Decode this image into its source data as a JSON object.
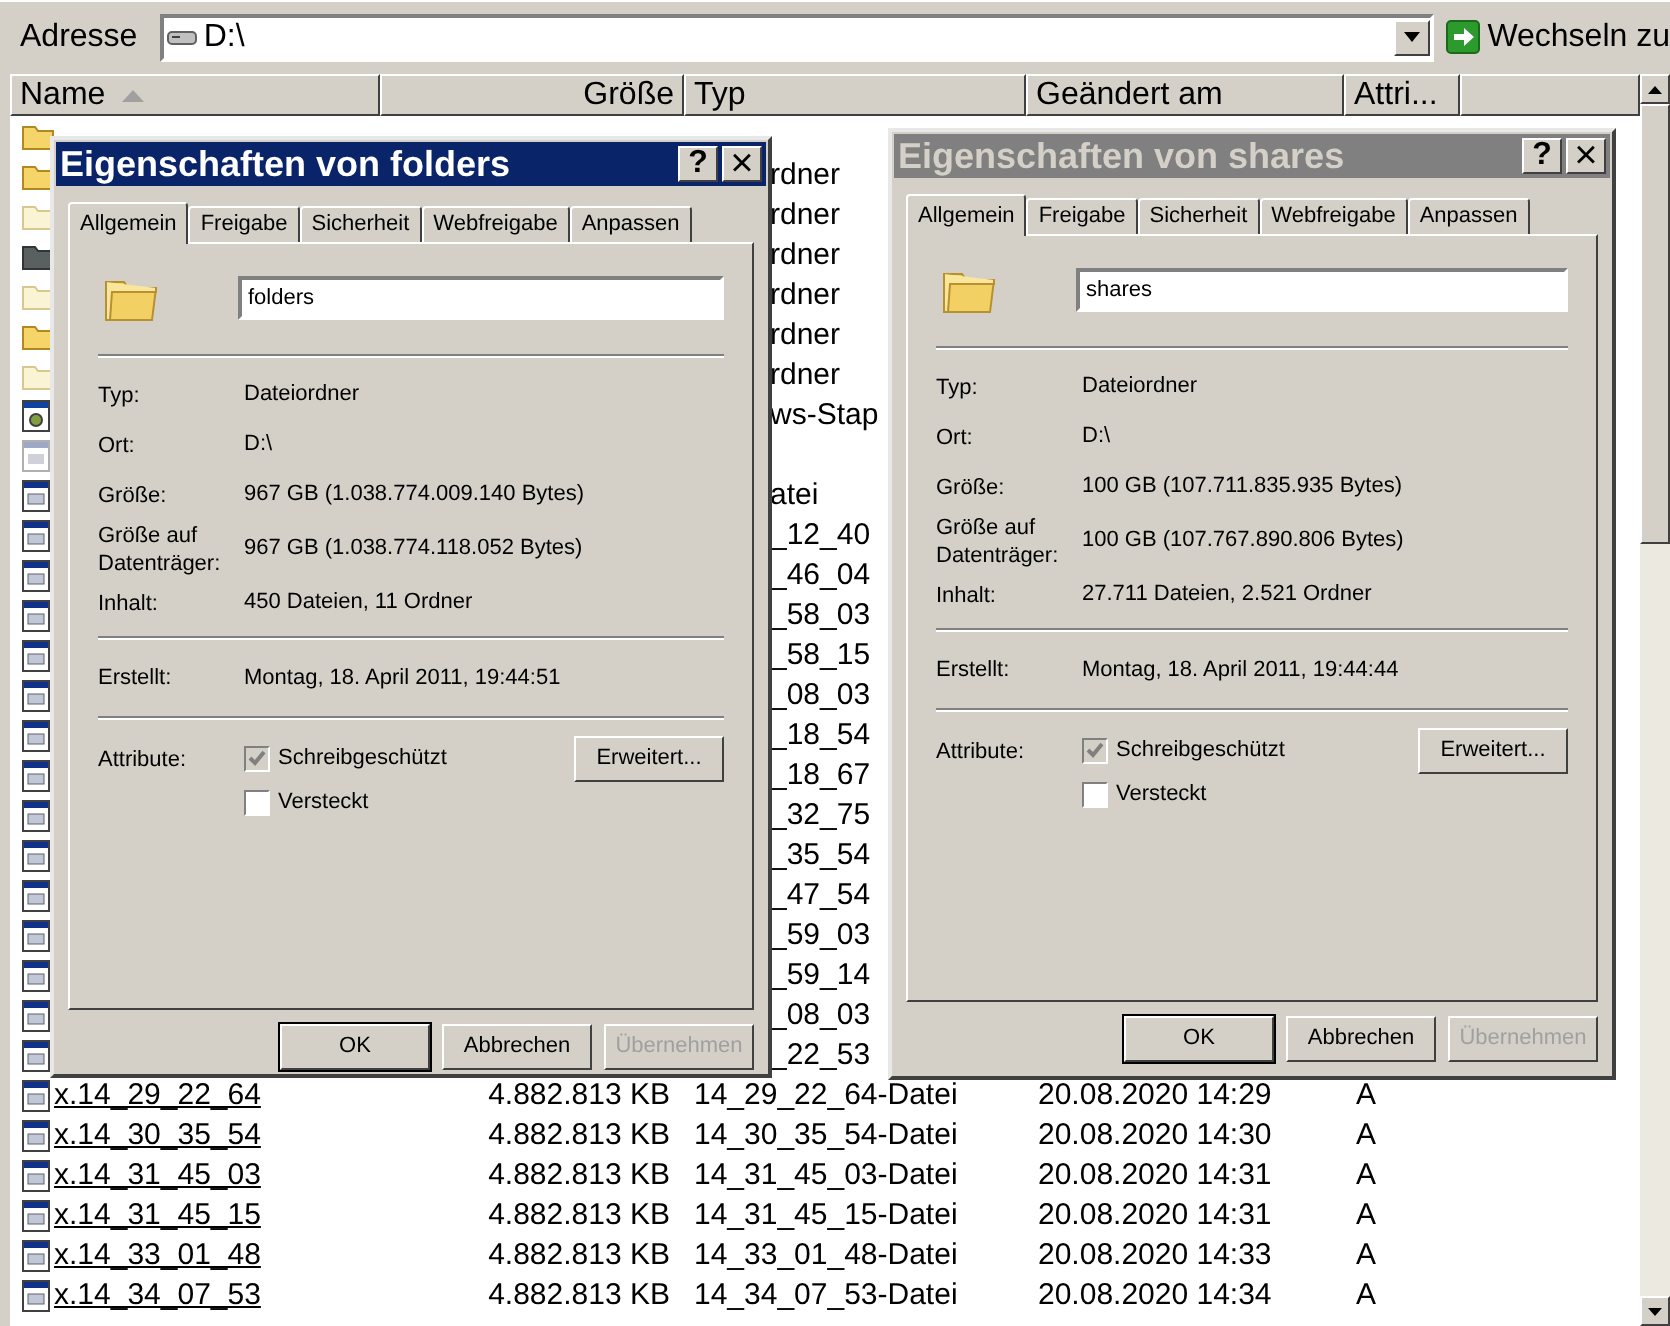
{
  "address_bar": {
    "label": "Adresse",
    "value": "D:\\",
    "go_button": "Wechseln zu"
  },
  "file_list": {
    "columns": [
      {
        "label": "Name",
        "sorted": true
      },
      {
        "label": "Größe",
        "sorted": false
      },
      {
        "label": "Typ",
        "sorted": false
      },
      {
        "label": "Geändert am",
        "sorted": false
      },
      {
        "label": "Attri...",
        "sorted": false
      }
    ],
    "rows": [
      {
        "kind": "folder"
      },
      {
        "kind": "folder",
        "type": "rdner"
      },
      {
        "kind": "ghostfolder",
        "type": "rdner"
      },
      {
        "kind": "darkfolder",
        "type": "rdner"
      },
      {
        "kind": "ghostfolder",
        "type": "rdner"
      },
      {
        "kind": "folder",
        "type": "rdner"
      },
      {
        "kind": "ghostfolder",
        "type": "rdner"
      },
      {
        "kind": "program",
        "type": "ws-Stap"
      },
      {
        "kind": "ghostfile"
      },
      {
        "kind": "file",
        "type": "atei"
      },
      {
        "kind": "file",
        "type": "_12_40"
      },
      {
        "kind": "file",
        "type": "_46_04"
      },
      {
        "kind": "file",
        "type": "_58_03"
      },
      {
        "kind": "file",
        "type": "_58_15"
      },
      {
        "kind": "file",
        "type": "_08_03"
      },
      {
        "kind": "file",
        "type": "_18_54"
      },
      {
        "kind": "file",
        "type": "_18_67"
      },
      {
        "kind": "file",
        "type": "_32_75"
      },
      {
        "kind": "file",
        "type": "_35_54"
      },
      {
        "kind": "file",
        "type": "_47_54"
      },
      {
        "kind": "file",
        "type": "_59_03"
      },
      {
        "kind": "file",
        "type": "_59_14"
      },
      {
        "kind": "file",
        "type": "_08_03"
      },
      {
        "kind": "file",
        "type": "_22_53"
      },
      {
        "kind": "file",
        "name": "x.14_29_22_64",
        "size": "4.882.813 KB",
        "type": "14_29_22_64-Datei",
        "modified": "20.08.2020 14:29",
        "attributes": "A"
      },
      {
        "kind": "file",
        "name": "x.14_30_35_54",
        "size": "4.882.813 KB",
        "type": "14_30_35_54-Datei",
        "modified": "20.08.2020 14:30",
        "attributes": "A"
      },
      {
        "kind": "file",
        "name": "x.14_31_45_03",
        "size": "4.882.813 KB",
        "type": "14_31_45_03-Datei",
        "modified": "20.08.2020 14:31",
        "attributes": "A"
      },
      {
        "kind": "file",
        "name": "x.14_31_45_15",
        "size": "4.882.813 KB",
        "type": "14_31_45_15-Datei",
        "modified": "20.08.2020 14:31",
        "attributes": "A"
      },
      {
        "kind": "file",
        "name": "x.14_33_01_48",
        "size": "4.882.813 KB",
        "type": "14_33_01_48-Datei",
        "modified": "20.08.2020 14:33",
        "attributes": "A"
      },
      {
        "kind": "file",
        "name": "x.14_34_07_53",
        "size": "4.882.813 KB",
        "type": "14_34_07_53-Datei",
        "modified": "20.08.2020 14:34",
        "attributes": "A"
      }
    ]
  },
  "dialogs": [
    {
      "title": "Eigenschaften von folders",
      "active": true,
      "help": "?",
      "close": "×",
      "tabs": [
        {
          "label": "Allgemein",
          "selected": true
        },
        {
          "label": "Freigabe",
          "selected": false
        },
        {
          "label": "Sicherheit",
          "selected": false
        },
        {
          "label": "Webfreigabe",
          "selected": false
        },
        {
          "label": "Anpassen",
          "selected": false
        }
      ],
      "name": "folders",
      "info": [
        {
          "label": "Typ:",
          "value": "Dateiordner"
        },
        {
          "label": "Ort:",
          "value": "D:\\"
        },
        {
          "label": "Größe:",
          "value": "967 GB (1.038.774.009.140 Bytes)"
        },
        {
          "label": "Größe auf Datenträger:",
          "value": "967 GB (1.038.774.118.052 Bytes)"
        },
        {
          "label": "Inhalt:",
          "value": "450 Dateien, 11 Ordner"
        }
      ],
      "created": {
        "label": "Erstellt:",
        "value": "Montag, 18. April 2011, 19:44:51"
      },
      "attributes_label": "Attribute:",
      "attributes": [
        {
          "label": "Schreibgeschützt",
          "checked": true,
          "greyed": true
        },
        {
          "label": "Versteckt",
          "checked": false,
          "greyed": false
        }
      ],
      "advanced_button": "Erweitert...",
      "buttons": [
        {
          "label": "OK",
          "default": true,
          "disabled": false
        },
        {
          "label": "Abbrechen",
          "default": false,
          "disabled": false
        },
        {
          "label": "Übernehmen",
          "default": false,
          "disabled": true
        }
      ]
    },
    {
      "title": "Eigenschaften von shares",
      "active": false,
      "help": "?",
      "close": "×",
      "tabs": [
        {
          "label": "Allgemein",
          "selected": true
        },
        {
          "label": "Freigabe",
          "selected": false
        },
        {
          "label": "Sicherheit",
          "selected": false
        },
        {
          "label": "Webfreigabe",
          "selected": false
        },
        {
          "label": "Anpassen",
          "selected": false
        }
      ],
      "name": "shares",
      "info": [
        {
          "label": "Typ:",
          "value": "Dateiordner"
        },
        {
          "label": "Ort:",
          "value": "D:\\"
        },
        {
          "label": "Größe:",
          "value": "100 GB (107.711.835.935 Bytes)"
        },
        {
          "label": "Größe auf Datenträger:",
          "value": "100 GB (107.767.890.806 Bytes)"
        },
        {
          "label": "Inhalt:",
          "value": "27.711 Dateien, 2.521 Ordner"
        }
      ],
      "created": {
        "label": "Erstellt:",
        "value": "Montag, 18. April 2011, 19:44:44"
      },
      "attributes_label": "Attribute:",
      "attributes": [
        {
          "label": "Schreibgeschützt",
          "checked": true,
          "greyed": true
        },
        {
          "label": "Versteckt",
          "checked": false,
          "greyed": false
        }
      ],
      "advanced_button": "Erweitert...",
      "buttons": [
        {
          "label": "OK",
          "default": true,
          "disabled": false
        },
        {
          "label": "Abbrechen",
          "default": false,
          "disabled": false
        },
        {
          "label": "Übernehmen",
          "default": false,
          "disabled": true
        }
      ]
    }
  ]
}
